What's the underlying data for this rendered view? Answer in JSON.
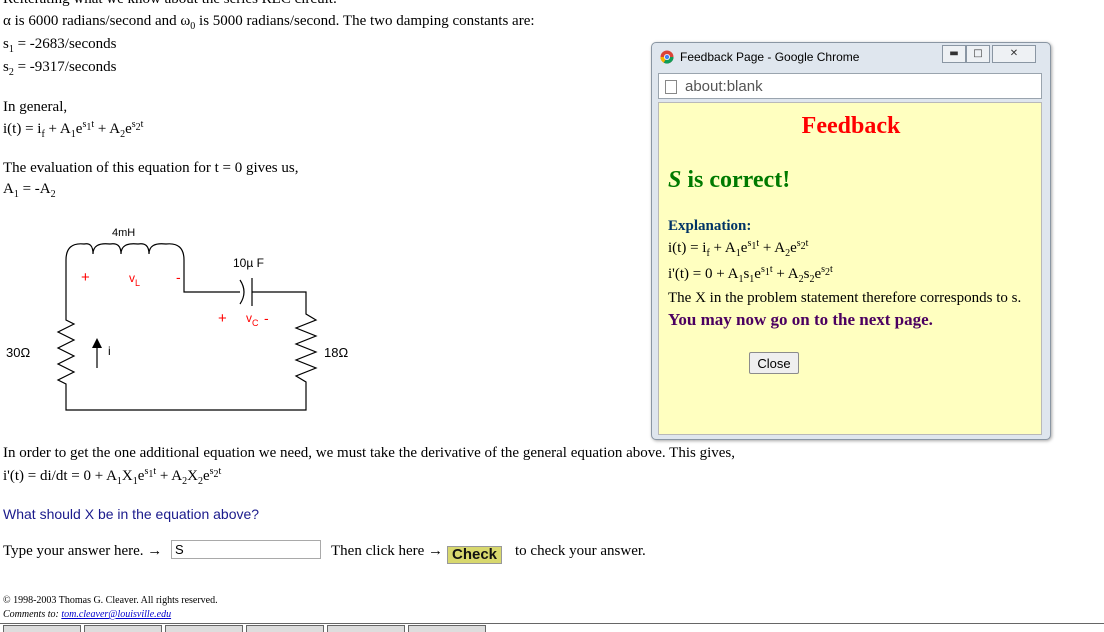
{
  "main": {
    "top_cut_text": "Reiterating what we know about the series RLC circuit:",
    "alpha_line": {
      "a": "α is 6000 radians/second and ω",
      "sub": "0",
      "b": " is 5000 radians/second. The two damping constants are:"
    },
    "s1_line": {
      "sym": "s",
      "sub": "1",
      "rest": " = -2683/seconds"
    },
    "s2_line": {
      "sym": "s",
      "sub": "2",
      "rest": " = -9317/seconds"
    },
    "in_general": "In general,",
    "general_eq": {
      "p1": "i(t) = i",
      "sub_f": "f",
      "p2": " + A",
      "sub_1": "1",
      "p3": "e",
      "sup_1": "s",
      "sup_1b": "1",
      "sup_1t": "t",
      "p4": " + A",
      "sub_2": "2",
      "p5": "e",
      "sup_2": "s",
      "sup_2b": "2",
      "sup_2t": "t"
    },
    "evaluation_text": "The evaluation of this equation for t = 0 gives us,",
    "a_relation": {
      "a": "A",
      "sub1": "1",
      "mid": " = -A",
      "sub2": "2"
    },
    "circuit": {
      "inductor_label": "4mH",
      "capacitor_label": "10µ F",
      "vl_plus": "+",
      "vl_label": "v",
      "vl_sub": "L",
      "vl_minus": "-",
      "vc_plus": "+",
      "vc_label": "v",
      "vc_sub": "C",
      "vc_minus": "-",
      "r_left_label": "30Ω",
      "r_right_label": "18Ω",
      "current_label": "i",
      "red": "#ff0000"
    },
    "derivative_text": "In order to get the one additional equation we need, we must take the derivative of the general equation above. This gives,",
    "derivative_eq": {
      "p1": "i'(t) = di/dt = 0 + A",
      "sub_1": "1",
      "x1": "X",
      "sub_x1": "1",
      "p2": "e",
      "sup_1": "s",
      "sup_1b": "1",
      "sup_1t": "t",
      "p3": " + A",
      "sub_2": "2",
      "x2": "X",
      "sub_x2": "2",
      "p4": "e",
      "sup_2": "s",
      "sup_2b": "2",
      "sup_2t": "t"
    },
    "question": "What should X be in the equation above?",
    "type_answer": "Type your answer here. →",
    "answer_value": "S",
    "then_click": "Then click here →",
    "check_label": "Check",
    "to_check": "to check your answer.",
    "copyright": "© 1998-2003 Thomas G. Cleaver. All rights reserved.",
    "comments_label": "Comments to: ",
    "comments_email": "tom.cleaver@louisville.edu",
    "question_color": "#1a1a8c"
  },
  "popup": {
    "title": "Feedback Page - Google Chrome",
    "address": "about:blank",
    "heading": "Feedback",
    "correct": {
      "var": "S",
      "rest": " is correct!"
    },
    "explanation_label": "Explanation:",
    "eq1": {
      "p1": "i(t) = i",
      "sub_f": "f",
      "p2": " + A",
      "sub_1": "1",
      "p3": "e",
      "sup_1": "s",
      "sup_1b": "1",
      "sup_1t": "t",
      "p4": " + A",
      "sub_2": "2",
      "p5": "e",
      "sup_2": "s",
      "sup_2b": "2",
      "sup_2t": "t"
    },
    "eq2": {
      "p1": "i'(t) = 0 + A",
      "sub_1": "1",
      "s1": "s",
      "sub_s1": "1",
      "p2": "e",
      "sup_1": "s",
      "sup_1b": "1",
      "sup_1t": "t",
      "p3": " + A",
      "sub_2": "2",
      "s2": "s",
      "sub_s2": "2",
      "p4": "e",
      "sup_2": "s",
      "sup_2b": "2",
      "sup_2t": "t"
    },
    "x_corresponds": "The X in the problem statement therefore corresponds to s.",
    "next_page": "You may now go on to the next page.",
    "close_label": "Close",
    "colors": {
      "heading": "#ff0000",
      "correct": "#007a00",
      "background": "#ffffc0"
    }
  }
}
